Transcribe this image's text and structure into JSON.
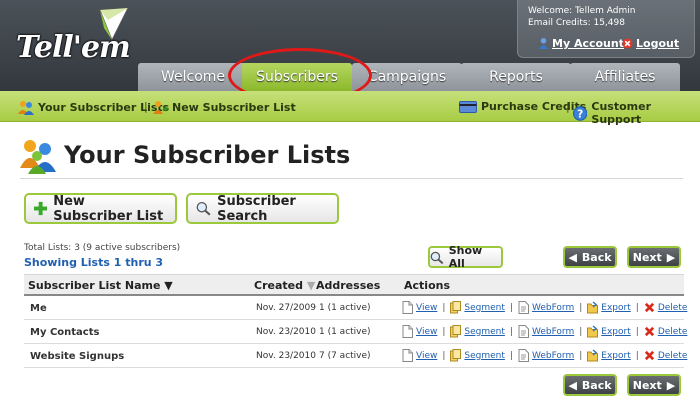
{
  "account": {
    "welcome": "Welcome: Tellem Admin",
    "credits": "Email Credits: 15,498",
    "my_account": "My Account",
    "logout": "Logout"
  },
  "logo": "Tell'em",
  "tabs": [
    {
      "label": "Welcome"
    },
    {
      "label": "Subscribers",
      "active": true
    },
    {
      "label": "Campaigns"
    },
    {
      "label": "Reports"
    },
    {
      "label": "Affiliates"
    }
  ],
  "subnav": {
    "lists": "Your Subscriber Lists",
    "new_list": "New Subscriber List",
    "purchase": "Purchase Credits",
    "support": "Customer Support"
  },
  "page": {
    "title": "Your Subscriber Lists",
    "new_list_button": "New Subscriber List",
    "search_button": "Subscriber Search",
    "totals": "Total Lists: 3 (9 active subscribers)",
    "showing": "Showing Lists 1 thru 3",
    "show_all": "Show All",
    "back": "Back",
    "next": "Next"
  },
  "table": {
    "headers": [
      "Subscriber List Name",
      "Created",
      "Addresses",
      "Actions"
    ],
    "action_labels": [
      "View",
      "Segment",
      "WebForm",
      "Export",
      "Delete"
    ],
    "rows": [
      {
        "name": "Me",
        "created": "Nov. 27/2009",
        "addresses": "1 (1 active)"
      },
      {
        "name": "My Contacts",
        "created": "Nov. 23/2010",
        "addresses": "1 (1 active)"
      },
      {
        "name": "Website Signups",
        "created": "Nov. 23/2010",
        "addresses": "7 (7 active)"
      }
    ]
  },
  "colors": {
    "brand_green": "#9cc83c",
    "header_dark": "#3a4046",
    "link_blue": "#2060b0",
    "highlight_red": "#e01818"
  }
}
